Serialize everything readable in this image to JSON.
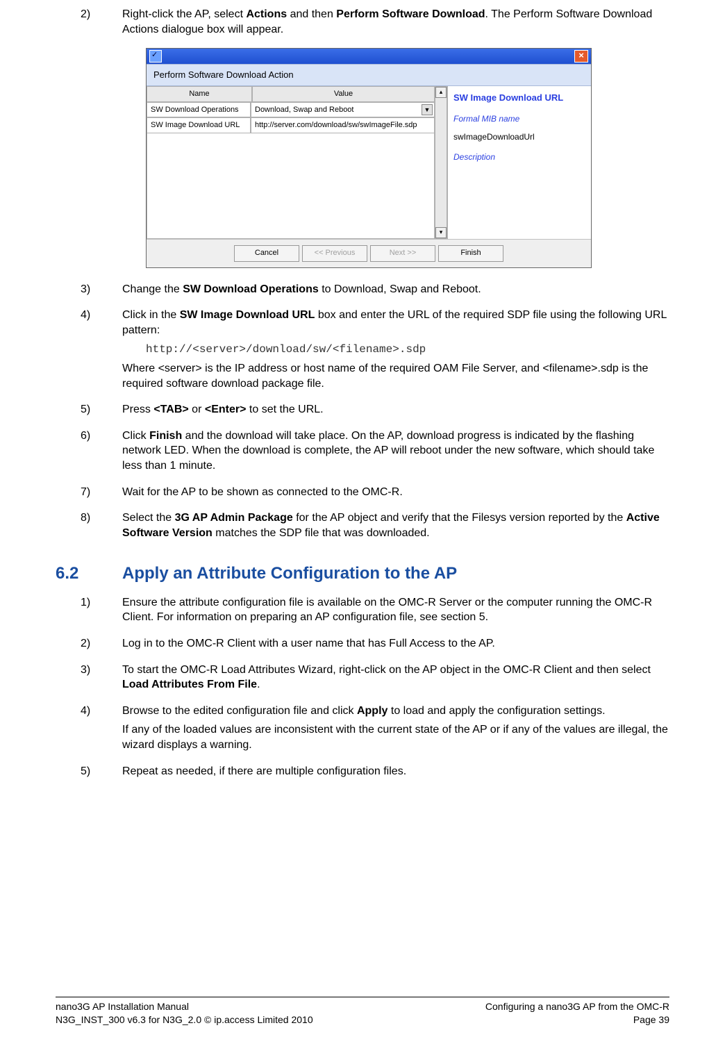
{
  "steps_top": {
    "s2": {
      "num": "2)",
      "p1a": "Right-click the AP, select ",
      "p1b": "Actions",
      "p1c": " and then ",
      "p1d": "Perform Software Download",
      "p1e": ". The Perform Software Download Actions dialogue box will appear."
    },
    "s3": {
      "num": "3)",
      "p1a": "Change the ",
      "p1b": "SW Download Operations",
      "p1c": " to Download, Swap and Reboot."
    },
    "s4": {
      "num": "4)",
      "p1a": "Click in the ",
      "p1b": "SW Image Download URL",
      "p1c": " box and enter the URL of the required SDP file using the following URL pattern:",
      "code": "http://<server>/download/sw/<filename>.sdp",
      "p2": "Where <server> is the IP address or host name of the required OAM File Server, and <filename>.sdp is the required software download package file."
    },
    "s5": {
      "num": "5)",
      "p1a": "Press ",
      "p1b": "<TAB>",
      "p1c": " or ",
      "p1d": "<Enter>",
      "p1e": " to set the URL."
    },
    "s6": {
      "num": "6)",
      "p1a": "Click ",
      "p1b": "Finish",
      "p1c": " and the download will take place. On the AP, download progress is indicated by the flashing network LED. When the download is complete, the AP will reboot under the new software, which should take less than 1 minute."
    },
    "s7": {
      "num": "7)",
      "p1": "Wait for the AP to be shown as connected to the OMC-R."
    },
    "s8": {
      "num": "8)",
      "p1a": "Select the ",
      "p1b": "3G AP Admin Package",
      "p1c": " for the AP object and verify that the Filesys version reported by the ",
      "p1d": "Active Software Version",
      "p1e": " matches the SDP file that was downloaded."
    }
  },
  "dialog": {
    "banner": "Perform Software Download Action",
    "head_name": "Name",
    "head_value": "Value",
    "row1_name": "SW Download Operations",
    "row1_value": "Download, Swap and Reboot",
    "row2_name": "SW Image Download URL",
    "row2_value": "http://server.com/download/sw/swImageFile.sdp",
    "side_heading": "SW Image Download URL",
    "side_mib_lbl": "Formal MIB name",
    "side_mib_val": "swImageDownloadUrl",
    "side_desc": "Description",
    "btn_cancel": "Cancel",
    "btn_prev": "<< Previous",
    "btn_next": "Next >>",
    "btn_finish": "Finish",
    "close_x": "×",
    "dd_arrow": "▼",
    "scroll_up": "▴",
    "scroll_dn": "▾"
  },
  "h62": {
    "num": "6.2",
    "title": "Apply an Attribute Configuration to the AP"
  },
  "steps62": {
    "s1": {
      "num": "1)",
      "p1": "Ensure the attribute configuration file is available on the OMC-R Server or the computer running the OMC-R Client. For information on preparing an AP configuration file, see section 5."
    },
    "s2": {
      "num": "2)",
      "p1": "Log in to the OMC-R Client with a user name that has Full Access to the AP."
    },
    "s3": {
      "num": "3)",
      "p1a": "To start the OMC-R Load Attributes Wizard, right-click on the AP object in the OMC-R Client and then select ",
      "p1b": "Load Attributes From File",
      "p1c": "."
    },
    "s4": {
      "num": "4)",
      "p1a": "Browse to the edited configuration file and click ",
      "p1b": "Apply",
      "p1c": " to load and apply the configuration settings.",
      "p2": "If any of the loaded values are inconsistent with the current state of the AP or if any of the values are illegal, the wizard displays a warning."
    },
    "s5": {
      "num": "5)",
      "p1": "Repeat as needed, if there are multiple configuration files."
    }
  },
  "footer": {
    "l1": "nano3G AP Installation Manual",
    "l2": "N3G_INST_300 v6.3 for N3G_2.0 © ip.access Limited 2010",
    "r1": "Configuring a nano3G AP from the OMC-R",
    "r2": "Page 39"
  }
}
